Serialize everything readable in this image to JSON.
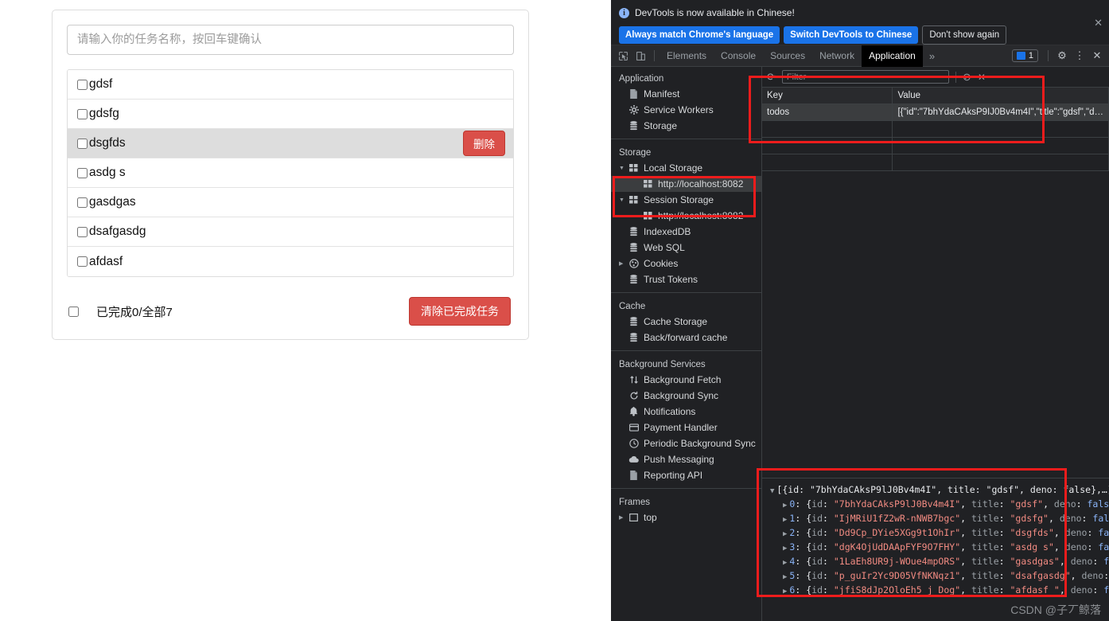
{
  "todo_app": {
    "input_placeholder": "请输入你的任务名称，按回车键确认",
    "input_value": "",
    "items": [
      {
        "label": "gdsf",
        "checked": false,
        "hovered": false
      },
      {
        "label": "gdsfg",
        "checked": false,
        "hovered": false
      },
      {
        "label": "dsgfds",
        "checked": false,
        "hovered": true,
        "delete_label": "删除"
      },
      {
        "label": "asdg s",
        "checked": false,
        "hovered": false
      },
      {
        "label": "gasdgas",
        "checked": false,
        "hovered": false
      },
      {
        "label": "dsafgasdg",
        "checked": false,
        "hovered": false
      },
      {
        "label": "afdasf",
        "checked": false,
        "hovered": false
      }
    ],
    "footer": {
      "select_all_checked": false,
      "summary": "已完成0/全部7",
      "clear_label": "清除已完成任务"
    }
  },
  "devtools": {
    "banner": {
      "message": "DevTools is now available in Chinese!",
      "btn_always": "Always match Chrome's language",
      "btn_switch": "Switch DevTools to Chinese",
      "btn_dismiss": "Don't show again",
      "close_glyph": "✕",
      "info_glyph": "i"
    },
    "tabs": [
      {
        "label": "Elements",
        "active": false
      },
      {
        "label": "Console",
        "active": false
      },
      {
        "label": "Sources",
        "active": false
      },
      {
        "label": "Network",
        "active": false
      },
      {
        "label": "Application",
        "active": true
      }
    ],
    "more_tabs_glyph": "»",
    "issues_count": "1",
    "toolbar_icons": {
      "settings_glyph": "⚙",
      "menu_glyph": "⋮",
      "close_glyph": "✕"
    },
    "sidebar": {
      "sections": [
        {
          "title": "Application",
          "items": [
            {
              "label": "Manifest",
              "icon": "document-icon",
              "depth": 1
            },
            {
              "label": "Service Workers",
              "icon": "gear-icon",
              "depth": 1
            },
            {
              "label": "Storage",
              "icon": "database-icon",
              "depth": 1
            }
          ]
        },
        {
          "title": "Storage",
          "items": [
            {
              "label": "Local Storage",
              "icon": "table-icon",
              "depth": 1,
              "expanded": true
            },
            {
              "label": "http://localhost:8082",
              "icon": "table-icon",
              "depth": 2,
              "selected": true
            },
            {
              "label": "Session Storage",
              "icon": "table-icon",
              "depth": 1,
              "expanded": true
            },
            {
              "label": "http://localhost:8082",
              "icon": "table-icon",
              "depth": 2
            },
            {
              "label": "IndexedDB",
              "icon": "database-icon",
              "depth": 1
            },
            {
              "label": "Web SQL",
              "icon": "database-icon",
              "depth": 1
            },
            {
              "label": "Cookies",
              "icon": "cookie-icon",
              "depth": 1,
              "collapsed": true
            },
            {
              "label": "Trust Tokens",
              "icon": "database-icon",
              "depth": 1
            }
          ]
        },
        {
          "title": "Cache",
          "items": [
            {
              "label": "Cache Storage",
              "icon": "database-icon",
              "depth": 1
            },
            {
              "label": "Back/forward cache",
              "icon": "database-icon",
              "depth": 1
            }
          ]
        },
        {
          "title": "Background Services",
          "items": [
            {
              "label": "Background Fetch",
              "icon": "updown-arrows-icon",
              "depth": 1
            },
            {
              "label": "Background Sync",
              "icon": "sync-icon",
              "depth": 1
            },
            {
              "label": "Notifications",
              "icon": "bell-icon",
              "depth": 1
            },
            {
              "label": "Payment Handler",
              "icon": "card-icon",
              "depth": 1
            },
            {
              "label": "Periodic Background Sync",
              "icon": "clock-icon",
              "depth": 1
            },
            {
              "label": "Push Messaging",
              "icon": "cloud-icon",
              "depth": 1
            },
            {
              "label": "Reporting API",
              "icon": "document-icon",
              "depth": 1
            }
          ]
        },
        {
          "title": "Frames",
          "items": [
            {
              "label": "top",
              "icon": "frame-icon",
              "depth": 1,
              "collapsed": true
            }
          ]
        }
      ]
    },
    "filter_bar": {
      "refresh_glyph": "⟳",
      "placeholder": "Filter",
      "value": "",
      "clear_all_glyph": "⊘",
      "delete_glyph": "✕"
    },
    "storage_table": {
      "columns": [
        "Key",
        "Value"
      ],
      "rows": [
        {
          "key": "todos",
          "value": "[{\"id\":\"7bhYdaCAksP9IJ0Bv4m4I\",\"title\":\"gdsf\",\"d…",
          "selected": true
        }
      ]
    },
    "preview": {
      "root_line": "[{id: \"7bhYdaCAksP9lJ0Bv4m4I\", title: \"gdsf\", deno: false},…]",
      "entries": [
        {
          "index": "0",
          "id": "7bhYdaCAksP9lJ0Bv4m4I",
          "title": "gdsf",
          "deno": "false"
        },
        {
          "index": "1",
          "id": "IjMRiU1fZ2wR-nNWB7bgc",
          "title": "gdsfg",
          "deno": "false"
        },
        {
          "index": "2",
          "id": "Dd9Cp_DYie5XGg9t1OhIr",
          "title": "dsgfds",
          "deno": "false"
        },
        {
          "index": "3",
          "id": "dgK4OjUdDAApFYF9O7FHY",
          "title": "asdg s",
          "deno": "false"
        },
        {
          "index": "4",
          "id": "1LaEh8UR9j-WOue4mpORS",
          "title": "gasdgas",
          "deno": "false"
        },
        {
          "index": "5",
          "id": "p_guIr2Yc9D05VfNKNqz1",
          "title": "dsafgasdg",
          "deno": "false"
        },
        {
          "index": "6",
          "id": "jfiS8dJp2OloEh5_j_Dog",
          "title": "afdasf ",
          "deno": "false"
        }
      ]
    }
  },
  "watermark": "CSDN @子丆鲸落",
  "colors": {
    "accent_blue": "#1a73e8",
    "danger_red": "#da4f49",
    "annotation_red": "#ee1c1c",
    "devtools_bg": "#202124",
    "devtools_panel": "#292a2d"
  }
}
